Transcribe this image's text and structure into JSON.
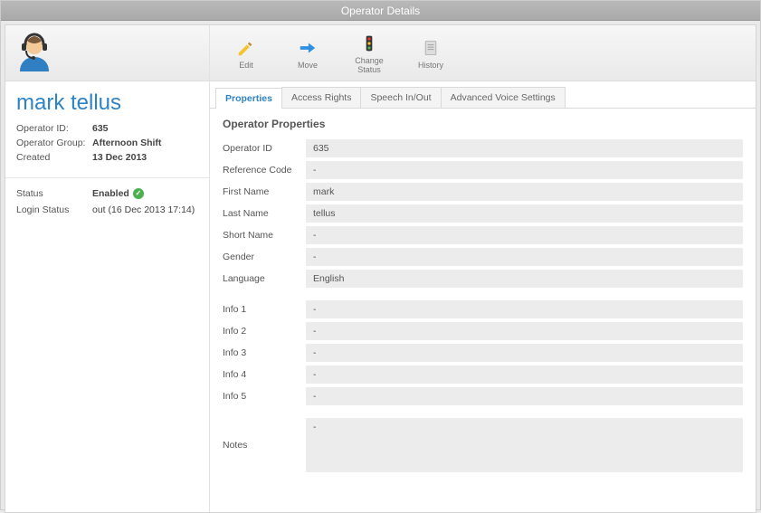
{
  "window": {
    "title": "Operator Details"
  },
  "toolbar": {
    "edit": "Edit",
    "move": "Move",
    "change_status": "Change\nStatus",
    "history": "History"
  },
  "operator": {
    "name": "mark tellus",
    "meta": {
      "id_label": "Operator ID:",
      "id_value": "635",
      "group_label": "Operator Group:",
      "group_value": "Afternoon Shift",
      "created_label": "Created",
      "created_value": "13 Dec 2013"
    },
    "status": {
      "status_label": "Status",
      "status_value": "Enabled",
      "login_label": "Login Status",
      "login_value": "out (16 Dec 2013 17:14)"
    }
  },
  "tabs": {
    "properties": "Properties",
    "access_rights": "Access Rights",
    "speech": "Speech In/Out",
    "advanced": "Advanced Voice Settings"
  },
  "panel": {
    "heading": "Operator Properties",
    "rows": {
      "operator_id": {
        "k": "Operator ID",
        "v": "635"
      },
      "reference_code": {
        "k": "Reference Code",
        "v": "-"
      },
      "first_name": {
        "k": "First Name",
        "v": "mark"
      },
      "last_name": {
        "k": "Last Name",
        "v": "tellus"
      },
      "short_name": {
        "k": "Short Name",
        "v": "-"
      },
      "gender": {
        "k": "Gender",
        "v": "-"
      },
      "language": {
        "k": "Language",
        "v": "English"
      },
      "info1": {
        "k": "Info 1",
        "v": "-"
      },
      "info2": {
        "k": "Info 2",
        "v": "-"
      },
      "info3": {
        "k": "Info 3",
        "v": "-"
      },
      "info4": {
        "k": "Info 4",
        "v": "-"
      },
      "info5": {
        "k": "Info 5",
        "v": "-"
      },
      "notes": {
        "k": "Notes",
        "v": "-"
      }
    }
  }
}
